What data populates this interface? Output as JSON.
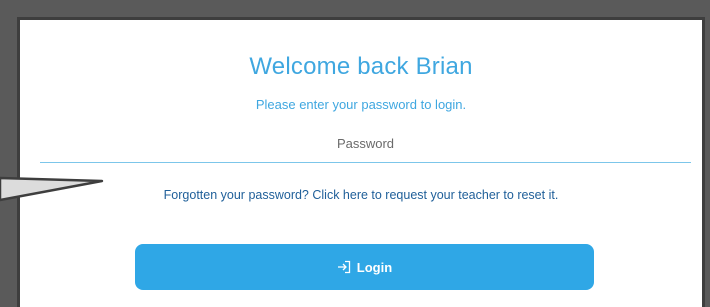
{
  "login": {
    "title": "Welcome back Brian",
    "subtitle": "Please enter your password to login.",
    "password_placeholder": "Password",
    "password_value": "",
    "forgot_link": "Forgotten your password? Click here to request your teacher to reset it.",
    "login_button": "Login",
    "login_icon": "login-arrow-icon"
  },
  "colors": {
    "accent": "#3fa7e0",
    "button": "#2fa7e6",
    "link": "#1f5f99",
    "frame": "#5a5a5a"
  }
}
